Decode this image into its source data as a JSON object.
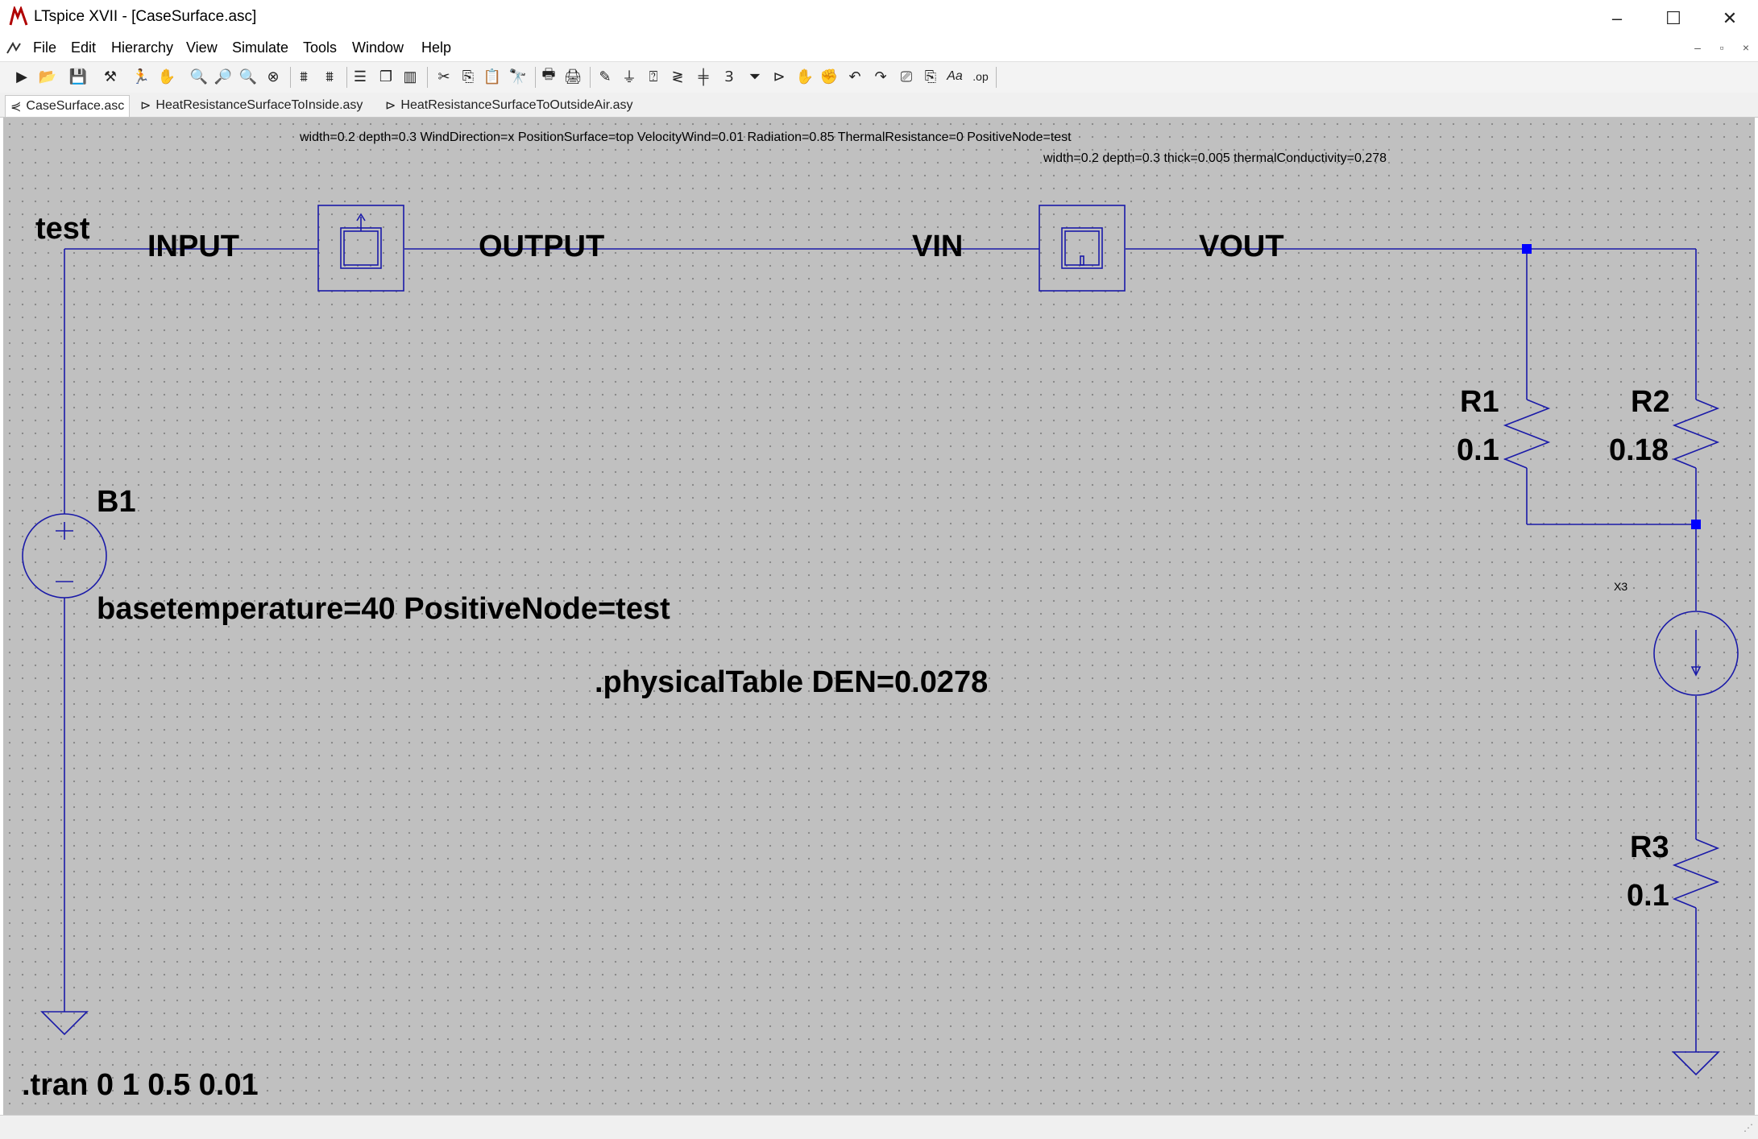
{
  "window": {
    "title": "LTspice XVII - [CaseSurface.asc]",
    "controls": [
      "–",
      "☐",
      "✕"
    ]
  },
  "menu": {
    "items": [
      "File",
      "Edit",
      "Hierarchy",
      "View",
      "Simulate",
      "Tools",
      "Window",
      "Help"
    ],
    "mdi_controls": [
      "–",
      "▫",
      "×"
    ]
  },
  "toolbar": {
    "icons": [
      "new-schematic-icon",
      "open-icon",
      "save-icon",
      "control-panel-icon",
      "run-icon",
      "halt-icon",
      "zoom-in-icon",
      "pan-icon",
      "zoom-out-icon",
      "zoom-fit-icon",
      "autorange-icon",
      "cancel-icon",
      "tile-horizontal-icon",
      "cascade-icon",
      "tile-vertical-icon",
      "cut-icon",
      "copy-icon",
      "paste-icon",
      "find-icon",
      "print-setup-icon",
      "print-icon",
      "draw-wire-icon",
      "ground-icon",
      "label-net-icon",
      "resistor-icon",
      "capacitor-icon",
      "inductor-icon",
      "diode-icon",
      "component-icon",
      "move-icon",
      "drag-icon",
      "undo-icon",
      "redo-icon",
      "rotate-icon",
      "mirror-icon",
      "text-icon",
      "spice-directive-icon"
    ],
    "text_button": "Aa",
    "op_button": ".op"
  },
  "tabs": [
    {
      "label": "CaseSurface.asc",
      "active": true
    },
    {
      "label": "HeatResistanceSurfaceToInside.asy",
      "active": false
    },
    {
      "label": "HeatResistanceSurfaceToOutsideAir.asy",
      "active": false
    }
  ],
  "schematic": {
    "params_top": "width=0.2 depth=0.3 WindDirection=x PositionSurface=top VelocityWind=0.01 Radiation=0.85 ThermalResistance=0 PositiveNode=test",
    "params_second": "width=0.2 depth=0.3 thick=0.005 thermalConductivity=0.278",
    "net_test": "test",
    "label_input": "INPUT",
    "label_output": "OUTPUT",
    "label_vin": "VIN",
    "label_vout": "VOUT",
    "b1_name": "B1",
    "b1_value": "basetemperature=40 PositiveNode=test",
    "physical_table": ".physicalTable DEN=0.0278",
    "r1_name": "R1",
    "r1_value": "0.1",
    "r2_name": "R2",
    "r2_value": "0.18",
    "r3_name": "R3",
    "r3_value": "0.1",
    "x3_name": "X3",
    "tran": ".tran 0 1 0.5 0.01"
  },
  "colors": {
    "wire": "#1a1aa8",
    "junction": "#0000ff",
    "background": "#c0c0c0"
  }
}
